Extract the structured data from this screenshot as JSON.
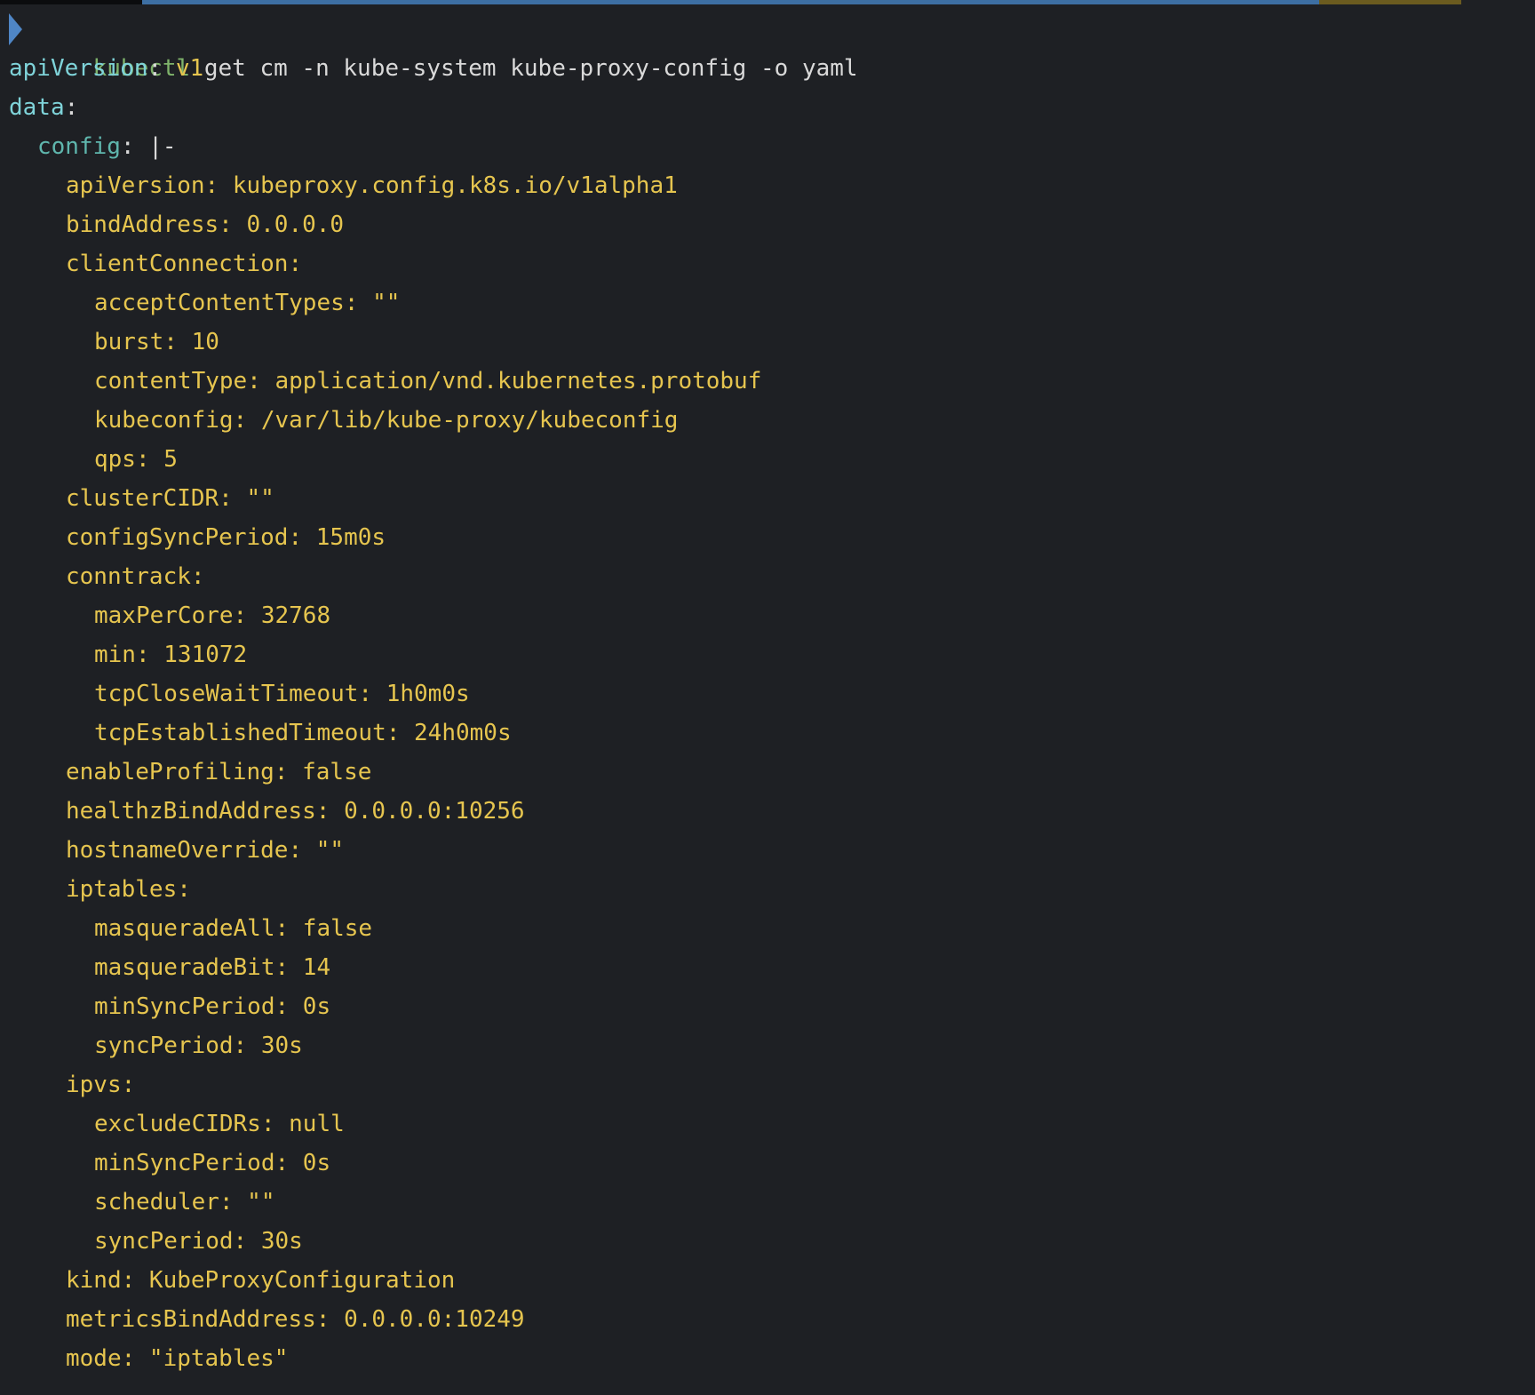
{
  "terminal": {
    "command": {
      "program": "kubectl",
      "args": "get cm -n kube-system kube-proxy-config -o yaml"
    },
    "top": [
      {
        "key": "apiVersion",
        "value": "v1"
      },
      {
        "key": "data",
        "value": ""
      }
    ],
    "config_key": "config",
    "config_value": "|-",
    "config_lines": [
      {
        "indent": 2,
        "text": "apiVersion: kubeproxy.config.k8s.io/v1alpha1"
      },
      {
        "indent": 2,
        "text": "bindAddress: 0.0.0.0"
      },
      {
        "indent": 2,
        "text": "clientConnection:"
      },
      {
        "indent": 3,
        "text": "acceptContentTypes: \"\""
      },
      {
        "indent": 3,
        "text": "burst: 10"
      },
      {
        "indent": 3,
        "text": "contentType: application/vnd.kubernetes.protobuf"
      },
      {
        "indent": 3,
        "text": "kubeconfig: /var/lib/kube-proxy/kubeconfig"
      },
      {
        "indent": 3,
        "text": "qps: 5"
      },
      {
        "indent": 2,
        "text": "clusterCIDR: \"\""
      },
      {
        "indent": 2,
        "text": "configSyncPeriod: 15m0s"
      },
      {
        "indent": 2,
        "text": "conntrack:"
      },
      {
        "indent": 3,
        "text": "maxPerCore: 32768"
      },
      {
        "indent": 3,
        "text": "min: 131072"
      },
      {
        "indent": 3,
        "text": "tcpCloseWaitTimeout: 1h0m0s"
      },
      {
        "indent": 3,
        "text": "tcpEstablishedTimeout: 24h0m0s"
      },
      {
        "indent": 2,
        "text": "enableProfiling: false"
      },
      {
        "indent": 2,
        "text": "healthzBindAddress: 0.0.0.0:10256"
      },
      {
        "indent": 2,
        "text": "hostnameOverride: \"\""
      },
      {
        "indent": 2,
        "text": "iptables:"
      },
      {
        "indent": 3,
        "text": "masqueradeAll: false"
      },
      {
        "indent": 3,
        "text": "masqueradeBit: 14"
      },
      {
        "indent": 3,
        "text": "minSyncPeriod: 0s"
      },
      {
        "indent": 3,
        "text": "syncPeriod: 30s"
      },
      {
        "indent": 2,
        "text": "ipvs:"
      },
      {
        "indent": 3,
        "text": "excludeCIDRs: null"
      },
      {
        "indent": 3,
        "text": "minSyncPeriod: 0s"
      },
      {
        "indent": 3,
        "text": "scheduler: \"\""
      },
      {
        "indent": 3,
        "text": "syncPeriod: 30s"
      },
      {
        "indent": 2,
        "text": "kind: KubeProxyConfiguration"
      },
      {
        "indent": 2,
        "text": "metricsBindAddress: 0.0.0.0:10249"
      },
      {
        "indent": 2,
        "text": "mode: \"iptables\""
      }
    ]
  },
  "colors": {
    "background": "#1e2024",
    "prompt_arrow": "#4f86c6",
    "command": "#7fb36b",
    "top_key": "#7fd3d9",
    "nested_key": "#5fb6ad",
    "config_text": "#e6c54f"
  },
  "icons": {
    "prompt": "prompt-chevron-icon"
  }
}
